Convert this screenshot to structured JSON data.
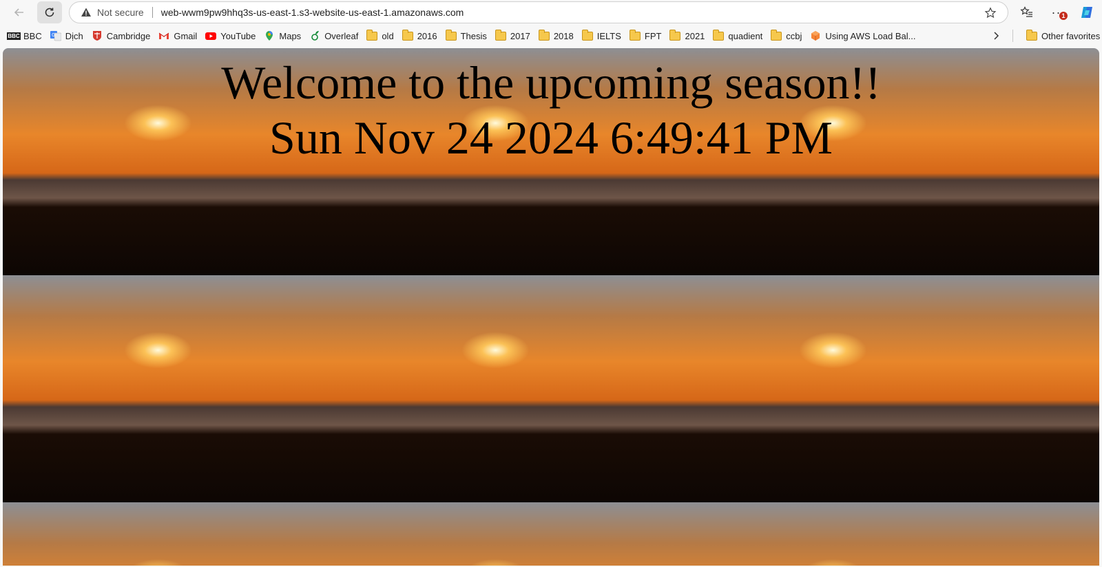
{
  "address_bar": {
    "security_label": "Not secure",
    "url": "web-wwm9pw9hhq3s-us-east-1.s3-website-us-east-1.amazonaws.com"
  },
  "toolbar": {
    "notification_count": "1"
  },
  "bookmarks": [
    {
      "label": "BBC",
      "icon": "bbc-icon"
    },
    {
      "label": "Dịch",
      "icon": "google-translate-icon"
    },
    {
      "label": "Cambridge",
      "icon": "cambridge-icon"
    },
    {
      "label": "Gmail",
      "icon": "gmail-icon"
    },
    {
      "label": "YouTube",
      "icon": "youtube-icon"
    },
    {
      "label": "Maps",
      "icon": "maps-icon"
    },
    {
      "label": "Overleaf",
      "icon": "overleaf-icon"
    },
    {
      "label": "old",
      "icon": "folder-icon"
    },
    {
      "label": "2016",
      "icon": "folder-icon"
    },
    {
      "label": "Thesis",
      "icon": "folder-icon"
    },
    {
      "label": "2017",
      "icon": "folder-icon"
    },
    {
      "label": "2018",
      "icon": "folder-icon"
    },
    {
      "label": "IELTS",
      "icon": "folder-icon"
    },
    {
      "label": "FPT",
      "icon": "folder-icon"
    },
    {
      "label": "2021",
      "icon": "folder-icon"
    },
    {
      "label": "quadient",
      "icon": "folder-icon"
    },
    {
      "label": "ccbj",
      "icon": "folder-icon"
    },
    {
      "label": "Using AWS Load Bal...",
      "icon": "aws-icon"
    }
  ],
  "other_favorites": "Other favorites",
  "page": {
    "heading": "Welcome to the upcoming season!!",
    "datetime": "Sun Nov 24 2024 6:49:41 PM"
  }
}
